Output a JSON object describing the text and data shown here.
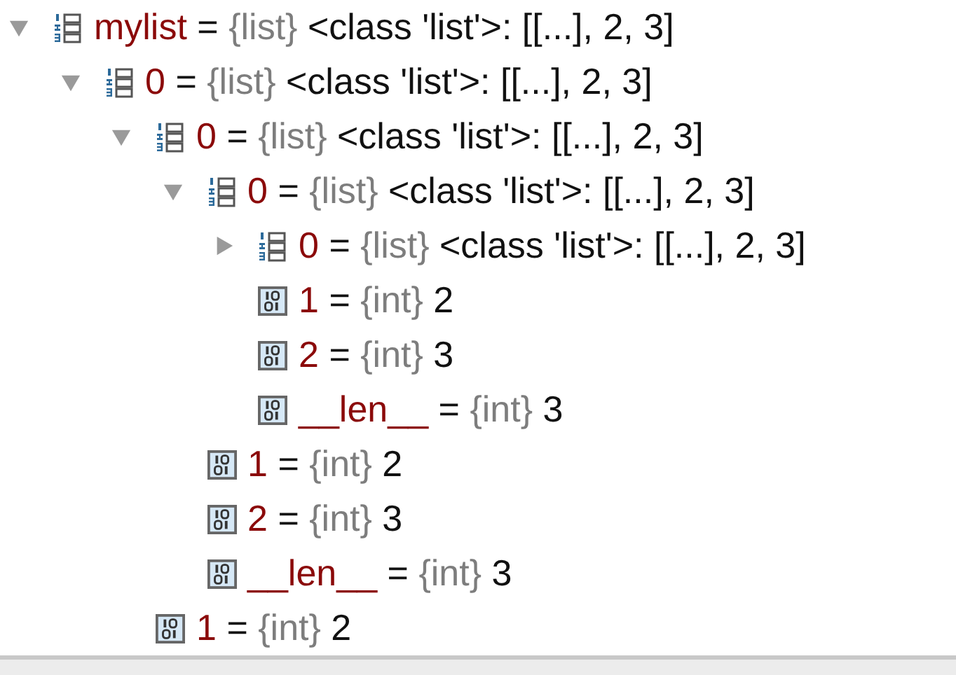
{
  "variables": [
    {
      "name": "mylist",
      "sep": "=",
      "kind": "list",
      "type": "{list}",
      "value": "<class 'list'>: [[...], 2, 3]",
      "expanded": true,
      "children": [
        {
          "name": "0",
          "sep": "=",
          "kind": "list",
          "type": "{list}",
          "value": "<class 'list'>: [[...], 2, 3]",
          "expanded": true,
          "children": [
            {
              "name": "0",
              "sep": "=",
              "kind": "list",
              "type": "{list}",
              "value": "<class 'list'>: [[...], 2, 3]",
              "expanded": true,
              "children": [
                {
                  "name": "0",
                  "sep": "=",
                  "kind": "list",
                  "type": "{list}",
                  "value": "<class 'list'>: [[...], 2, 3]",
                  "expanded": true,
                  "children": [
                    {
                      "name": "0",
                      "sep": "=",
                      "kind": "list",
                      "type": "{list}",
                      "value": "<class 'list'>: [[...], 2, 3]",
                      "expanded": false
                    },
                    {
                      "name": "1",
                      "sep": "=",
                      "kind": "int",
                      "type": "{int}",
                      "value": "2"
                    },
                    {
                      "name": "2",
                      "sep": "=",
                      "kind": "int",
                      "type": "{int}",
                      "value": "3"
                    },
                    {
                      "name": "__len__",
                      "sep": "=",
                      "kind": "int",
                      "type": "{int}",
                      "value": "3"
                    }
                  ]
                },
                {
                  "name": "1",
                  "sep": "=",
                  "kind": "int",
                  "type": "{int}",
                  "value": "2"
                },
                {
                  "name": "2",
                  "sep": "=",
                  "kind": "int",
                  "type": "{int}",
                  "value": "3"
                },
                {
                  "name": "__len__",
                  "sep": "=",
                  "kind": "int",
                  "type": "{int}",
                  "value": "3"
                }
              ]
            },
            {
              "name": "1",
              "sep": "=",
              "kind": "int",
              "type": "{int}",
              "value": "2"
            }
          ]
        }
      ]
    }
  ]
}
